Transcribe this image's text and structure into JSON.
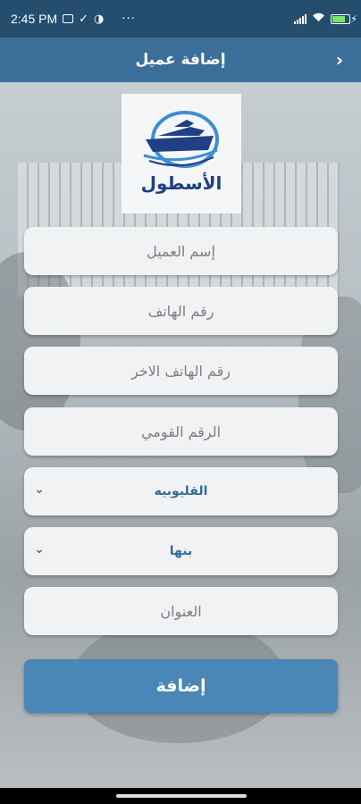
{
  "status_bar": {
    "time": "2:45 PM",
    "dots": "···",
    "battery_level": 0.7,
    "icons": [
      "screen-icon",
      "check-icon",
      "data-saver-icon",
      "signal-icon",
      "wifi-icon",
      "battery-icon",
      "charging-icon"
    ]
  },
  "app_bar": {
    "title": "إضافة عميل",
    "back_icon": "chevron-right-icon"
  },
  "logo": {
    "text": "الأسطول",
    "colors": {
      "primary": "#1f3f86",
      "accent": "#3c8fd0"
    }
  },
  "form": {
    "customer_name_placeholder": "إسم العميل",
    "phone_placeholder": "رقم الهاتف",
    "other_phone_placeholder": "رقم الهاتف الاخر",
    "national_id_placeholder": "الرقم القومي",
    "governorate_value": "القليوبيه",
    "city_value": "بنها",
    "address_placeholder": "العنوان"
  },
  "submit": {
    "label": "إضافة"
  },
  "colors": {
    "status_bar": "#244d6e",
    "app_bar": "#3b6f99",
    "button": "#4a86b6",
    "select_text": "#2f6d9b"
  }
}
